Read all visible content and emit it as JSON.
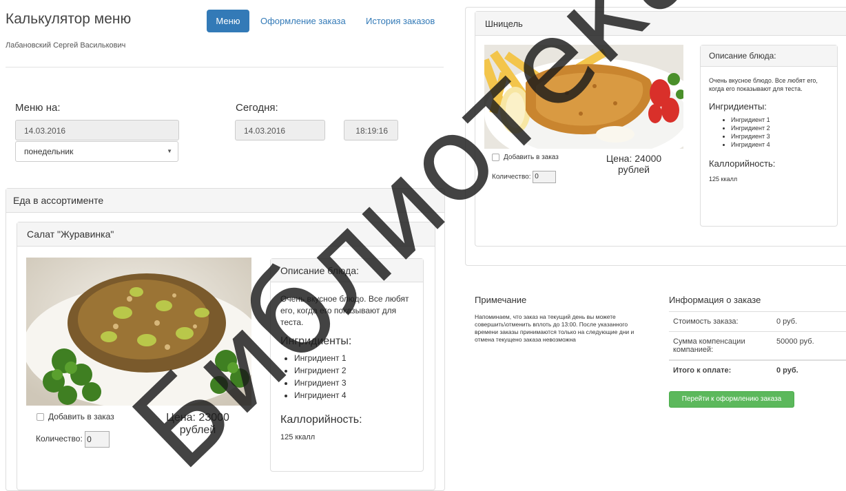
{
  "header": {
    "title": "Калькулятор меню",
    "user": "Лабановский Сергей Василькович"
  },
  "nav": {
    "menu": "Меню",
    "order": "Оформление заказа",
    "history": "История заказов"
  },
  "menu_for": {
    "label": "Меню на:",
    "date": "14.03.2016",
    "weekday": "понедельник"
  },
  "today": {
    "label": "Сегодня:",
    "date": "14.03.2016",
    "time": "18:19:16"
  },
  "assortment": {
    "title": "Еда в ассортименте"
  },
  "dish1": {
    "name": "Салат \"Журавинка\"",
    "desc_title": "Описание блюда:",
    "desc": "Очень вкусное блюдо. Все любят его, когда его показывают для теста.",
    "ingredients_title": "Ингридиенты:",
    "ingredients": [
      "Ингридиент 1",
      "Ингридиент 2",
      "Ингридиент 3",
      "Ингридиент 4"
    ],
    "calories_title": "Каллорийность:",
    "calories": "125 ккалл",
    "add_label": "Добавить в заказ",
    "qty_label": "Количество:",
    "qty_value": "0",
    "price_line1": "Цена: 23000",
    "price_line2": "рублей"
  },
  "dish2": {
    "name": "Шницель",
    "desc_title": "Описание блюда:",
    "desc": "Очень вкусное блюдо. Все любят его, когда его показывают для теста.",
    "ingredients_title": "Ингридиенты:",
    "ingredients": [
      "Ингридиент 1",
      "Ингридиент 2",
      "Ингридиент 3",
      "Ингридиент 4"
    ],
    "calories_title": "Каллорийность:",
    "calories": "125 ккалл",
    "add_label": "Добавить в заказ",
    "qty_label": "Количество:",
    "qty_value": "0",
    "price_line1": "Цена: 24000",
    "price_line2": "рублей"
  },
  "note": {
    "title": "Примечание",
    "text": "Напоминаем, что заказ на текущий день вы можете совершить\\отменить вплоть до 13:00. После указанного времени заказы принимаются только на следующие дни и отмена текущено заказа невозможна"
  },
  "order_info": {
    "title": "Информация о заказе",
    "rows": [
      {
        "label": "Стоимость заказа:",
        "value": "0 руб."
      },
      {
        "label": "Сумма компенсации компанией:",
        "value": "50000 руб."
      },
      {
        "label": "Итого к оплате:",
        "value": "0 руб."
      }
    ],
    "button": "Перейти к оформлению заказа"
  },
  "colors": {
    "primary": "#337ab7",
    "success": "#5cb85c",
    "watermark": "#1a1a1a"
  },
  "watermark": "Библиотека БГУИР"
}
